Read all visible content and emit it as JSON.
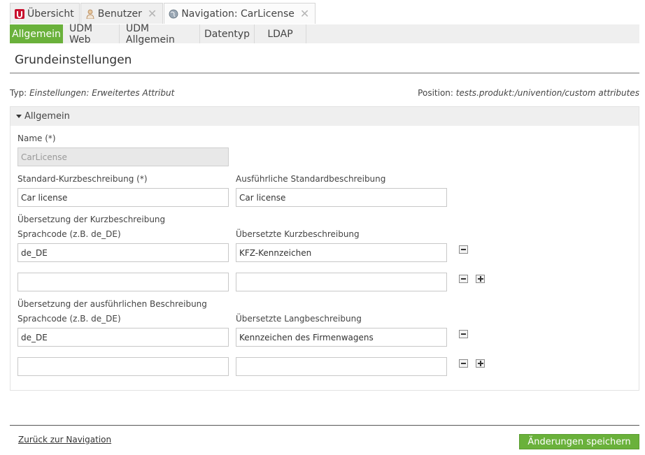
{
  "top_tabs": [
    {
      "label": "Übersicht",
      "icon": "univention-logo-icon",
      "closable": false
    },
    {
      "label": "Benutzer",
      "icon": "user-icon",
      "closable": true
    },
    {
      "label": "Navigation: CarLicense",
      "icon": "globe-icon",
      "closable": true
    }
  ],
  "sub_tabs": [
    "Allgemein",
    "UDM Web",
    "UDM Allgemein",
    "Datentyp",
    "LDAP"
  ],
  "section_title": "Grundeinstellungen",
  "typ": {
    "prefix": "Typ:",
    "value": "Einstellungen: Erweitertes Attribut"
  },
  "position": {
    "prefix": "Position:",
    "value": "tests.produkt:/univention/custom attributes"
  },
  "panel": {
    "header": "Allgemein",
    "name_label": "Name (*)",
    "name_value": "CarLicense",
    "short_desc_label": "Standard-Kurzbeschreibung (*)",
    "short_desc_value": "Car license",
    "long_desc_label": "Ausführliche Standardbeschreibung",
    "long_desc_value": "Car license",
    "short_trans": {
      "title": "Übersetzung der Kurzbeschreibung",
      "lang_label": "Sprachcode (z.B. de_DE)",
      "text_label": "Übersetzte Kurzbeschreibung",
      "rows": [
        {
          "lang": "de_DE",
          "text": "KFZ-Kennzeichen"
        },
        {
          "lang": "",
          "text": ""
        }
      ]
    },
    "long_trans": {
      "title": "Übersetzung der ausführlichen Beschreibung",
      "lang_label": "Sprachcode (z.B. de_DE)",
      "text_label": "Übersetzte Langbeschreibung",
      "rows": [
        {
          "lang": "de_DE",
          "text": "Kennzeichen des Firmenwagens"
        },
        {
          "lang": "",
          "text": ""
        }
      ]
    }
  },
  "footer": {
    "back_link": "Zurück zur Navigation",
    "save_button": "Änderungen speichern"
  },
  "colors": {
    "accent_green": "#6ab13b",
    "univention_red": "#c8102e"
  }
}
